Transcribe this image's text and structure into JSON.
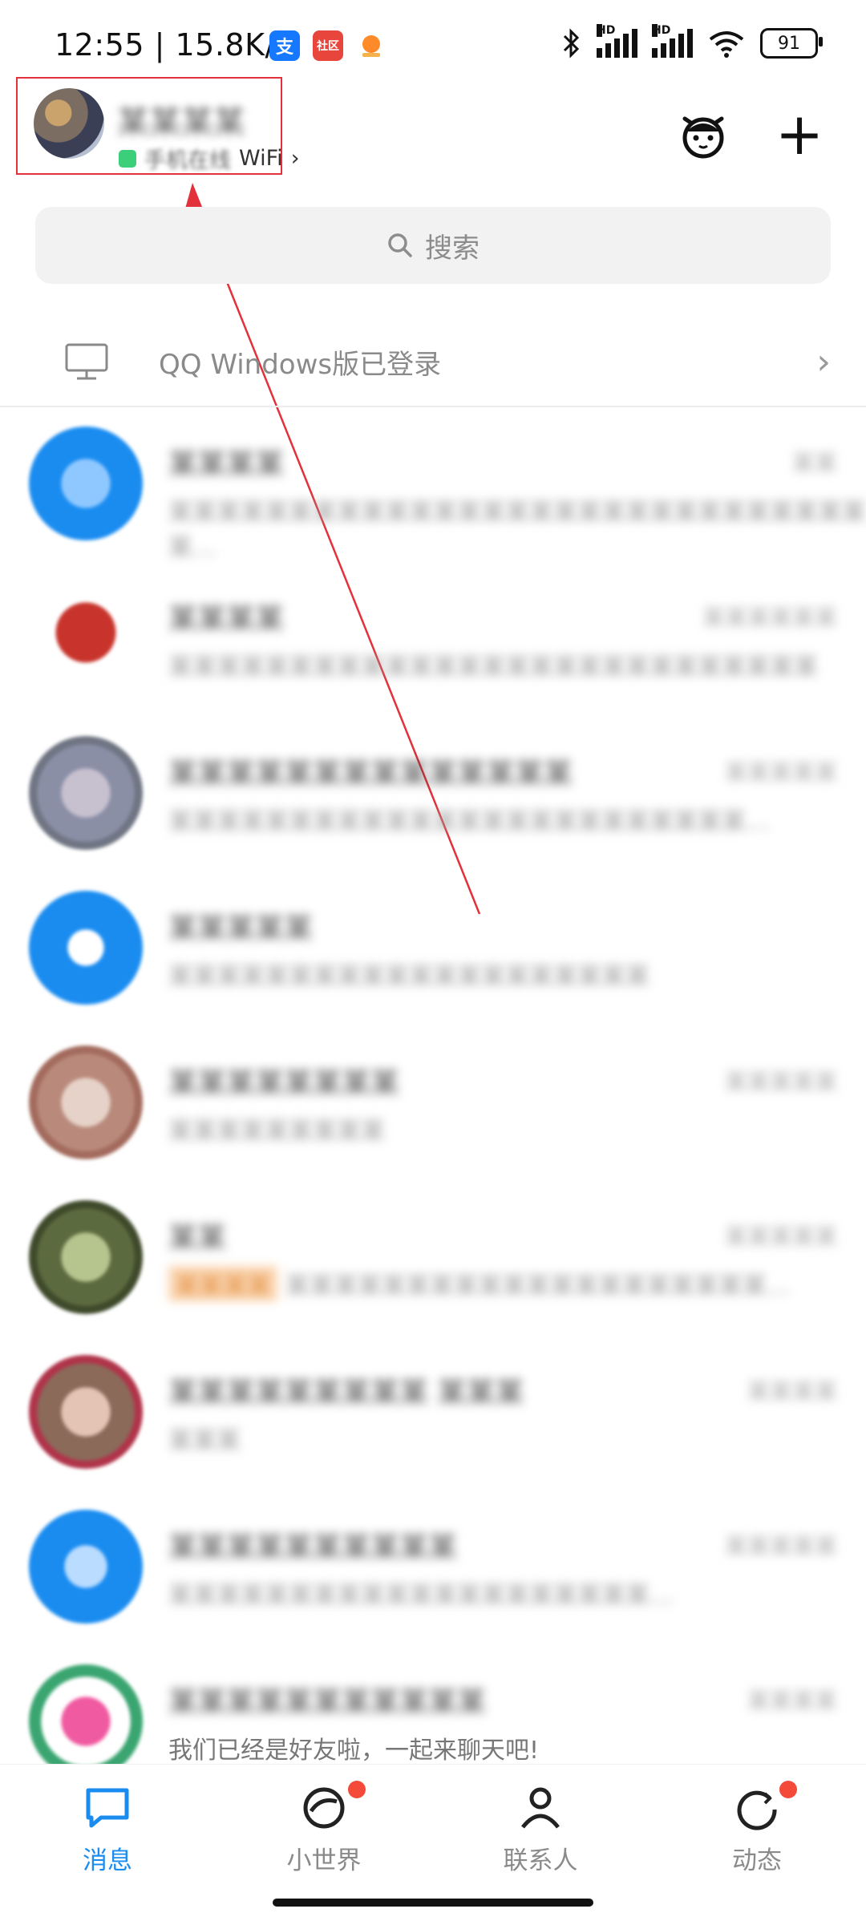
{
  "status_bar": {
    "time": "12:55",
    "net_speed": "15.8K/s",
    "app_icons": [
      {
        "name": "alipay-icon",
        "glyph": "支",
        "color": "#1677ff"
      },
      {
        "name": "community-app-icon",
        "glyph": "社区",
        "color": "#e8453c"
      },
      {
        "name": "orange-app-icon",
        "glyph": "",
        "color": "#ff8a2a"
      }
    ],
    "signal_label": "HD",
    "battery": "91"
  },
  "header": {
    "profile_name": "某某某某",
    "status_text": "手机在线",
    "network": "WiFi",
    "network_chevron": "›",
    "plus_symbol": "+"
  },
  "search": {
    "label": "搜索",
    "icon": "search-icon"
  },
  "login_banner": {
    "text": "QQ Windows版已登录",
    "chevron": "›"
  },
  "messages": [
    {
      "title": "某某某某",
      "time": "某某",
      "snippet": "某某某某某某某某某某某某某某某某某某某某某某某某某某某某某某…",
      "avatar": "#1a8cf0"
    },
    {
      "title": "某某某某",
      "time": "某某某某某某",
      "snippet": "某某某某某某某某某某某某某某某某某某某某某某某某某某某",
      "avatar": "#c8342c"
    },
    {
      "title": "某某某某某某某某某某某某某某",
      "time": "某某某某某",
      "snippet": "某某某某某某某某某某某某某某某某某某某某某某某某…",
      "avatar": "#8a8fa6"
    },
    {
      "title": "某某某某某",
      "time": "",
      "snippet": "某某某某某某某某某某某某某某某某某某某某",
      "avatar": "#1a8cf0"
    },
    {
      "title": "某某某某某某某某",
      "time": "某某某某某",
      "snippet": "某某某某某某某某某",
      "avatar": "#b98a7c"
    },
    {
      "title": "某某",
      "time": "某某某某某",
      "tag": "某某某某",
      "snippet": "某某某某某某某某某某某某某某某某某某某某…",
      "avatar": "#5c6b3f"
    },
    {
      "title": "某某某某某某某某某 某某某",
      "time": "某某某某",
      "snippet": "某某某",
      "avatar": "#8b6a5a"
    },
    {
      "title": "某某某某某某某某某某",
      "time": "某某某某某",
      "snippet": "某某某某某某某某某某某某某某某某某某某某…",
      "avatar": "#1a8cf0"
    },
    {
      "title": "某某某某某某某某某某某",
      "time": "某某某某",
      "snippet": "我们已经是好友啦，一起来聊天吧!",
      "avatar": "#3aa570"
    }
  ],
  "tabs": [
    {
      "label": "消息",
      "active": true
    },
    {
      "label": "小世界",
      "active": false,
      "badge": true
    },
    {
      "label": "联系人",
      "active": false
    },
    {
      "label": "动态",
      "active": false,
      "badge": true
    }
  ],
  "colors": {
    "accent": "#1a8cf0",
    "badge": "#f44a3a",
    "highlight": "#e2313a"
  }
}
